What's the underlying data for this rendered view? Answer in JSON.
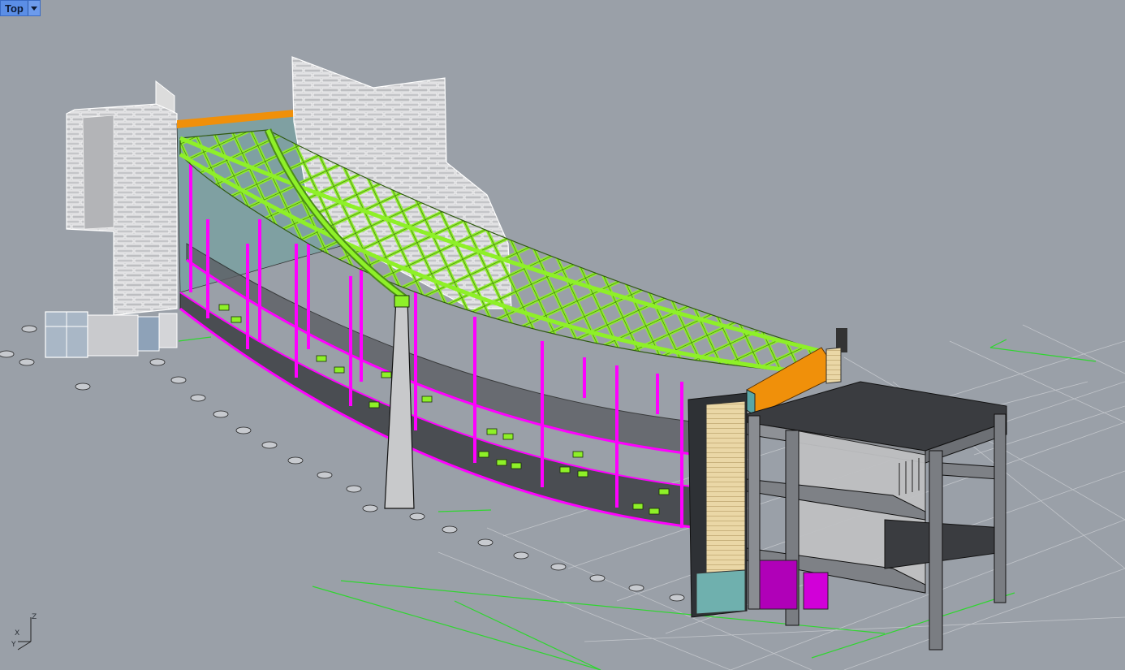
{
  "viewport": {
    "title": "Top",
    "menu_icon": "chevron-down-icon"
  },
  "axis_widget": {
    "labels": [
      "Z",
      "Y",
      "X"
    ]
  },
  "colors": {
    "background": "#9aa0a8",
    "truss": "#8ef028",
    "columns": "#ff00ff",
    "stone": "#d8d8d8",
    "gridlines": "#2fd62f",
    "slab": "#4a4d52",
    "beam_highlight": "#f0900a"
  }
}
